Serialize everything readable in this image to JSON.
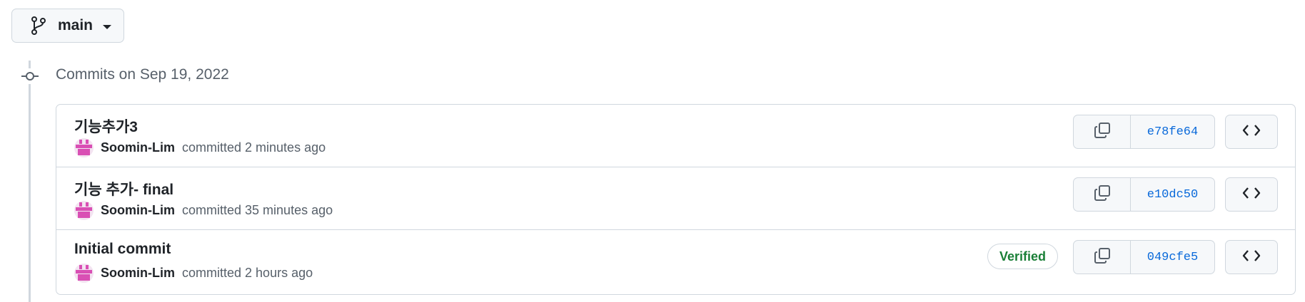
{
  "branch": {
    "name": "main",
    "icon": "git-branch-icon"
  },
  "timeline": {
    "date_heading": "Commits on Sep 19, 2022"
  },
  "colors": {
    "verified": "#1a7f37",
    "link": "#0969da",
    "border": "#d0d7de",
    "avatar": "#d94fb4"
  },
  "commits": [
    {
      "title": "기능추가3",
      "author": "Soomin-Lim",
      "action": "committed",
      "time": "2 minutes ago",
      "sha": "e78fe64",
      "verified": false
    },
    {
      "title": "기능 추가- final",
      "author": "Soomin-Lim",
      "action": "committed",
      "time": "35 minutes ago",
      "sha": "e10dc50",
      "verified": false
    },
    {
      "title": "Initial commit",
      "author": "Soomin-Lim",
      "action": "committed",
      "time": "2 hours ago",
      "sha": "049cfe5",
      "verified": true,
      "verified_label": "Verified"
    }
  ]
}
